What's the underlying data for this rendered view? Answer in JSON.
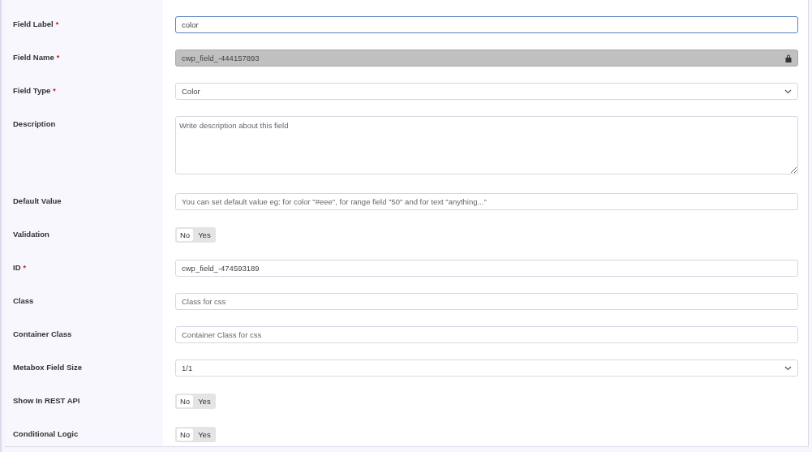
{
  "fields": [
    {
      "label": "Field Label",
      "required": "*",
      "kind": "text",
      "value": "color",
      "focused": true
    },
    {
      "label": "Field Name",
      "required": "*",
      "kind": "locked",
      "value": "cwp_field_-444157893"
    },
    {
      "label": "Field Type",
      "required": "*",
      "kind": "select",
      "value": "Color"
    },
    {
      "label": "Description",
      "kind": "textarea",
      "placeholder": "Write description about this field"
    },
    {
      "label": "Default Value",
      "kind": "text",
      "placeholder": "You can set default value eg: for color \"#eee\", for range field \"50\" and for text \"anything...\"",
      "focused": false
    },
    {
      "label": "Validation",
      "kind": "toggle",
      "options": [
        {
          "label": "No",
          "selected": true
        },
        {
          "label": "Yes",
          "selected": false
        }
      ]
    },
    {
      "label": "ID",
      "required": "*",
      "kind": "text",
      "value": "cwp_field_-474593189",
      "focused": false
    },
    {
      "label": "Class",
      "kind": "text",
      "placeholder": "Class for css",
      "focused": false
    },
    {
      "label": "Container Class",
      "kind": "text",
      "placeholder": "Container Class for css",
      "focused": false
    },
    {
      "label": "Metabox Field Size",
      "kind": "select",
      "value": "1/1"
    },
    {
      "label": "Show In REST API",
      "kind": "toggle",
      "options": [
        {
          "label": "No",
          "selected": true
        },
        {
          "label": "Yes",
          "selected": false
        }
      ]
    },
    {
      "label": "Conditional Logic",
      "kind": "toggle",
      "options": [
        {
          "label": "No",
          "selected": true
        },
        {
          "label": "Yes",
          "selected": false
        }
      ]
    }
  ]
}
